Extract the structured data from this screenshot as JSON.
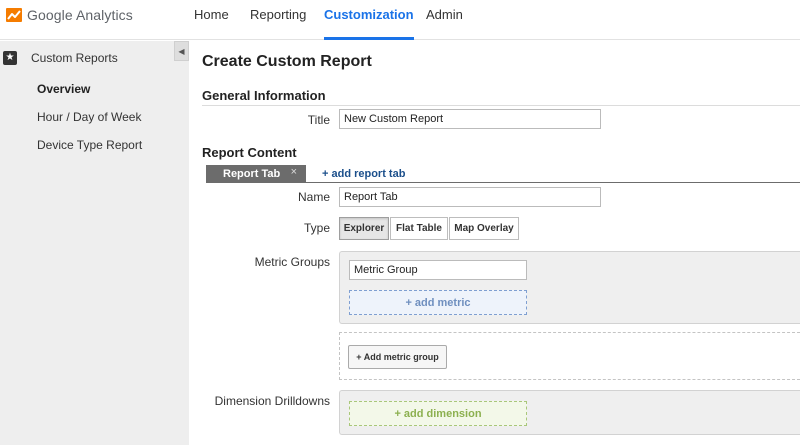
{
  "header": {
    "logo_text": "Google Analytics",
    "nav": [
      {
        "label": "Home",
        "active": false
      },
      {
        "label": "Reporting",
        "active": false
      },
      {
        "label": "Customization",
        "active": true
      },
      {
        "label": "Admin",
        "active": false
      }
    ],
    "accent_color": "#1a73e8"
  },
  "sidebar": {
    "collapse_icon": "chevron-left-icon",
    "section_icon": "star-icon",
    "section_label": "Custom Reports",
    "items": [
      {
        "label": "Overview",
        "active": true
      },
      {
        "label": "Hour / Day of Week",
        "active": false
      },
      {
        "label": "Device Type Report",
        "active": false
      }
    ]
  },
  "main": {
    "page_title": "Create Custom Report",
    "general": {
      "heading": "General Information",
      "title_label": "Title",
      "title_value": "New Custom Report"
    },
    "content": {
      "heading": "Report Content",
      "tab_label": "Report Tab",
      "tab_close": "×",
      "add_tab_label": "+ add report tab",
      "name_label": "Name",
      "name_value": "Report Tab",
      "type_label": "Type",
      "types": [
        {
          "label": "Explorer",
          "active": true
        },
        {
          "label": "Flat Table",
          "active": false
        },
        {
          "label": "Map Overlay",
          "active": false
        }
      ],
      "metric_groups_label": "Metric Groups",
      "metric_group_value": "Metric Group",
      "add_metric_label": "+ add metric",
      "add_metric_group_label": "+ Add metric group",
      "dimension_label": "Dimension Drilldowns",
      "add_dimension_label": "+ add dimension"
    }
  }
}
